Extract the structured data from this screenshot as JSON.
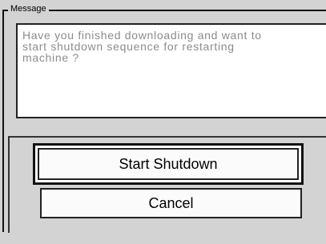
{
  "dialog": {
    "legend": "Message",
    "message_lines": "Have you finished downloading and want to\nstart shutdown sequence for restarting\nmachine ?"
  },
  "buttons": {
    "start_shutdown": "Start Shutdown",
    "cancel": "Cancel"
  },
  "colors": {
    "background": "#d3d3d3",
    "message_text": "#8c8c8c",
    "border": "#111111",
    "button_face": "#fbfbfb"
  }
}
